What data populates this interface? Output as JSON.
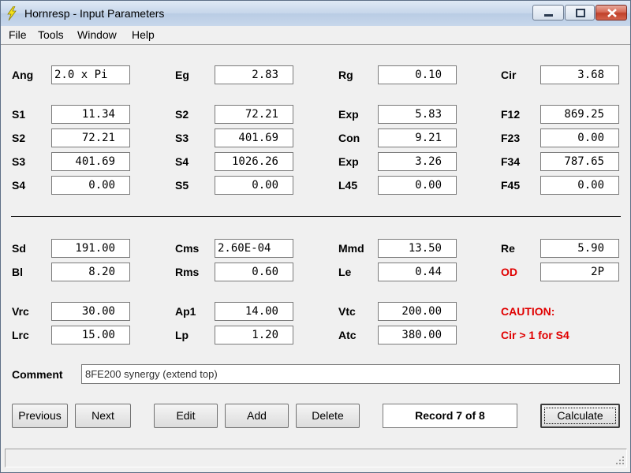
{
  "window": {
    "title": "Hornresp - Input Parameters"
  },
  "menu": [
    "File",
    "Tools",
    "Window",
    "Help"
  ],
  "params": {
    "Ang": {
      "label": "Ang",
      "value": "2.0 x Pi"
    },
    "Eg": {
      "label": "Eg",
      "value": "2.83"
    },
    "Rg": {
      "label": "Rg",
      "value": "0.10"
    },
    "Cir": {
      "label": "Cir",
      "value": "3.68"
    },
    "S1": {
      "label": "S1",
      "value": "11.34"
    },
    "S2a": {
      "label": "S2",
      "value": "72.21"
    },
    "Exp1": {
      "label": "Exp",
      "value": "5.83"
    },
    "F12": {
      "label": "F12",
      "value": "869.25"
    },
    "S2b": {
      "label": "S2",
      "value": "72.21"
    },
    "S3a": {
      "label": "S3",
      "value": "401.69"
    },
    "Con": {
      "label": "Con",
      "value": "9.21"
    },
    "F23": {
      "label": "F23",
      "value": "0.00"
    },
    "S3b": {
      "label": "S3",
      "value": "401.69"
    },
    "S4a": {
      "label": "S4",
      "value": "1026.26"
    },
    "Exp2": {
      "label": "Exp",
      "value": "3.26"
    },
    "F34": {
      "label": "F34",
      "value": "787.65"
    },
    "S4b": {
      "label": "S4",
      "value": "0.00"
    },
    "S5": {
      "label": "S5",
      "value": "0.00"
    },
    "L45": {
      "label": "L45",
      "value": "0.00"
    },
    "F45": {
      "label": "F45",
      "value": "0.00"
    },
    "Sd": {
      "label": "Sd",
      "value": "191.00"
    },
    "Cms": {
      "label": "Cms",
      "value": "2.60E-04"
    },
    "Mmd": {
      "label": "Mmd",
      "value": "13.50"
    },
    "Re": {
      "label": "Re",
      "value": "5.90"
    },
    "Bl": {
      "label": "Bl",
      "value": "8.20"
    },
    "Rms": {
      "label": "Rms",
      "value": "0.60"
    },
    "Le": {
      "label": "Le",
      "value": "0.44"
    },
    "OD": {
      "label": "OD",
      "value": "2P"
    },
    "Vrc": {
      "label": "Vrc",
      "value": "30.00"
    },
    "Ap1": {
      "label": "Ap1",
      "value": "14.00"
    },
    "Vtc": {
      "label": "Vtc",
      "value": "200.00"
    },
    "Lrc": {
      "label": "Lrc",
      "value": "15.00"
    },
    "Lp": {
      "label": "Lp",
      "value": "1.20"
    },
    "Atc": {
      "label": "Atc",
      "value": "380.00"
    }
  },
  "caution": {
    "title": "CAUTION:",
    "message": "Cir > 1 for S4"
  },
  "comment": {
    "label": "Comment",
    "value": "8FE200 synergy (extend top)"
  },
  "buttons": {
    "previous": "Previous",
    "next": "Next",
    "edit": "Edit",
    "add": "Add",
    "delete": "Delete",
    "calculate": "Calculate"
  },
  "record": "Record 7 of 8",
  "status": "",
  "colors": {
    "warning": "#e00000",
    "title_gradient": "#c6d6ea"
  }
}
